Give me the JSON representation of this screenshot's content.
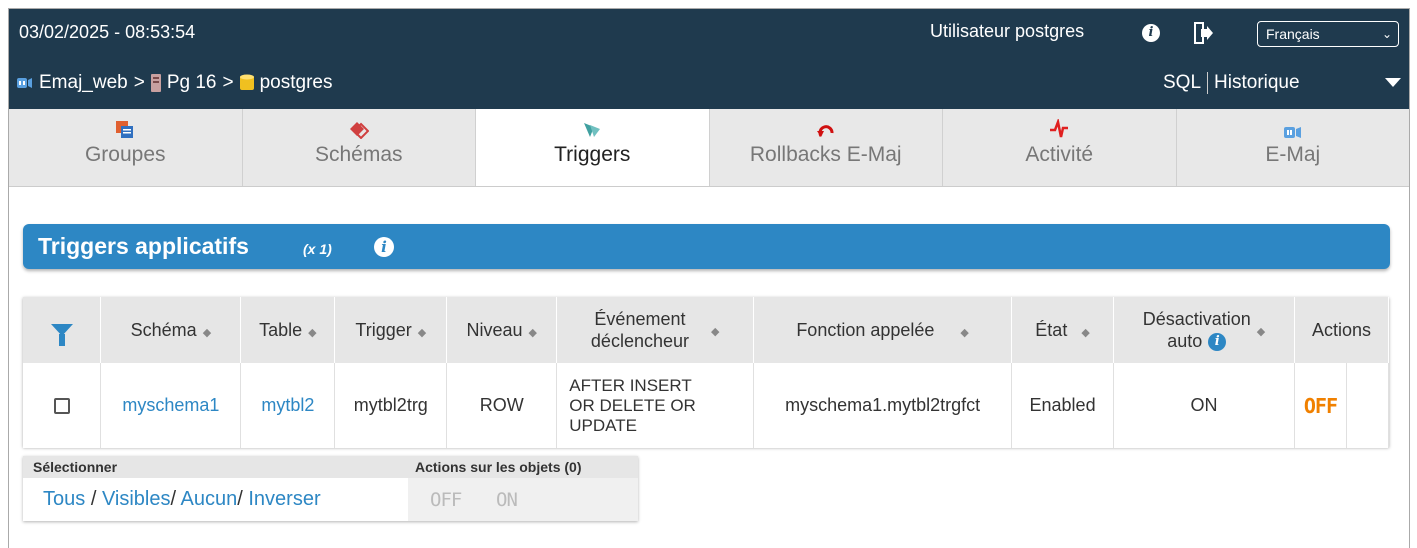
{
  "header": {
    "datetime": "03/02/2025 - 08:53:54",
    "user_prefix": "Utilisateur",
    "user_name": "postgres",
    "language": "Français"
  },
  "breadcrumb": {
    "app": "Emaj_web",
    "server": "Pg 16",
    "database": "postgres"
  },
  "topnav": {
    "sql": "SQL",
    "history": "Historique"
  },
  "tabs": [
    {
      "label": "Groupes",
      "icon": "groups-icon"
    },
    {
      "label": "Schémas",
      "icon": "schemas-icon"
    },
    {
      "label": "Triggers",
      "icon": "triggers-icon",
      "active": true
    },
    {
      "label": "Rollbacks E-Maj",
      "icon": "rollback-icon"
    },
    {
      "label": "Activité",
      "icon": "activity-icon"
    },
    {
      "label": "E-Maj",
      "icon": "emaj-icon"
    }
  ],
  "section": {
    "title": "Triggers applicatifs",
    "count": "(x 1)"
  },
  "table": {
    "columns": {
      "schema": "Schéma",
      "table": "Table",
      "trigger": "Trigger",
      "level": "Niveau",
      "event_l1": "Événement",
      "event_l2": "déclencheur",
      "function": "Fonction appelée",
      "state": "État",
      "autodisable_l1": "Désactivation",
      "autodisable_l2": "auto",
      "actions": "Actions"
    },
    "rows": [
      {
        "schema": "myschema1",
        "table": "mytbl2",
        "trigger": "mytbl2trg",
        "level": "ROW",
        "event_l1": "AFTER INSERT",
        "event_l2": "OR DELETE OR",
        "event_l3": "UPDATE",
        "function": "myschema1.mytbl2trgfct",
        "state": "Enabled",
        "autodisable": "ON",
        "action": "OFF"
      }
    ]
  },
  "selection": {
    "select_label": "Sélectionner",
    "actions_label": "Actions sur les objets (0)",
    "all": "Tous",
    "visible": "Visibles",
    "none": "Aucun",
    "invert": "Inverser",
    "sep": "/",
    "off": "OFF",
    "on": "ON"
  },
  "colors": {
    "topbar": "#1f3a4e",
    "accent": "#2d87c4",
    "off_button": "#f08000"
  }
}
